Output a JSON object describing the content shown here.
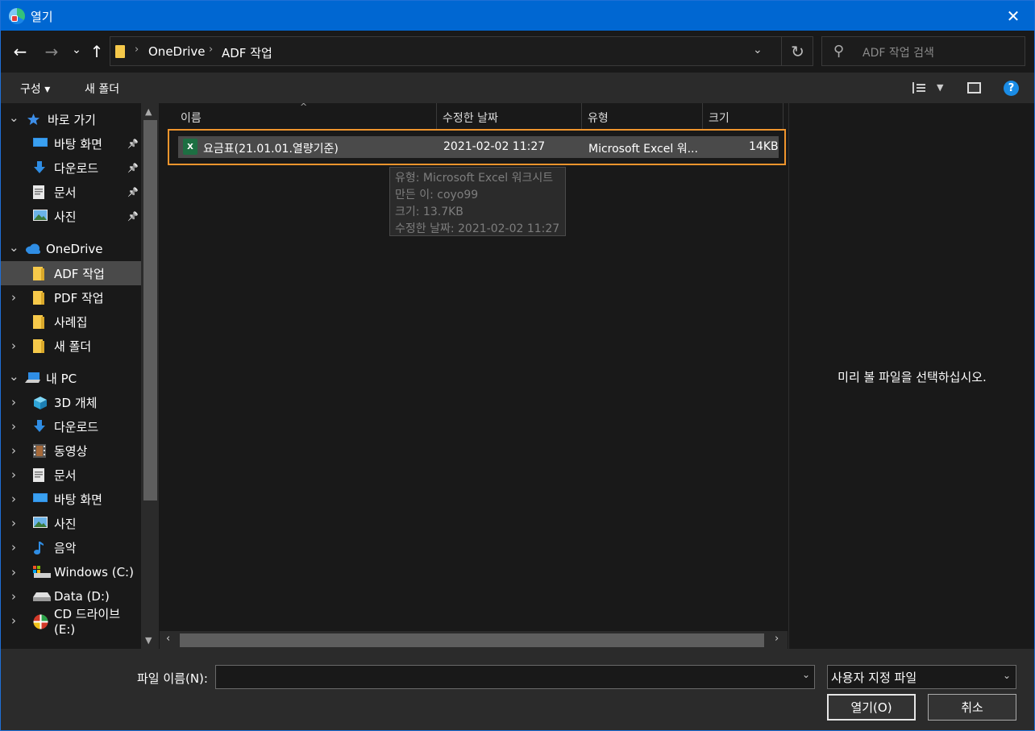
{
  "window": {
    "title": "열기",
    "close_glyph": "✕"
  },
  "nav": {
    "back_glyph": "←",
    "forward_glyph": "→",
    "recent_glyph": "⌄",
    "up_glyph": "↑",
    "breadcrumb": [
      "OneDrive",
      "ADF 작업"
    ],
    "refresh_glyph": "↻",
    "search_placeholder": "ADF 작업 검색"
  },
  "toolbar": {
    "organize_label": "구성 ▾",
    "new_folder_label": "새 폴더",
    "help_glyph": "?"
  },
  "sidebar": {
    "items": [
      {
        "label": "바로 가기",
        "icon": "star-icon",
        "chevron": "⌄"
      },
      {
        "label": "바탕 화면",
        "icon": "desktop-icon",
        "pinned": true
      },
      {
        "label": "다운로드",
        "icon": "download-icon",
        "pinned": true
      },
      {
        "label": "문서",
        "icon": "document-icon",
        "pinned": true
      },
      {
        "label": "사진",
        "icon": "pictures-icon",
        "pinned": true
      },
      {
        "label": "OneDrive",
        "icon": "cloud-icon",
        "chevron": "⌄"
      },
      {
        "label": "ADF 작업",
        "icon": "folder-icon",
        "selected": true
      },
      {
        "label": "PDF 작업",
        "icon": "folder-icon",
        "chevron": "›"
      },
      {
        "label": "사례집",
        "icon": "folder-icon"
      },
      {
        "label": "새 폴더",
        "icon": "folder-icon",
        "chevron": "›"
      },
      {
        "label": "내 PC",
        "icon": "pc-icon",
        "chevron": "⌄"
      },
      {
        "label": "3D 개체",
        "icon": "cube-icon",
        "chevron": "›"
      },
      {
        "label": "다운로드",
        "icon": "download-icon",
        "chevron": "›"
      },
      {
        "label": "동영상",
        "icon": "video-icon",
        "chevron": "›"
      },
      {
        "label": "문서",
        "icon": "document-icon",
        "chevron": "›"
      },
      {
        "label": "바탕 화면",
        "icon": "desktop-icon",
        "chevron": "›"
      },
      {
        "label": "사진",
        "icon": "pictures-icon",
        "chevron": "›"
      },
      {
        "label": "음악",
        "icon": "music-icon",
        "chevron": "›"
      },
      {
        "label": "Windows (C:)",
        "icon": "drive-c-icon",
        "chevron": "›"
      },
      {
        "label": "Data (D:)",
        "icon": "drive-d-icon",
        "chevron": "›"
      },
      {
        "label": "CD 드라이브 (E:)",
        "icon": "cd-drive-icon",
        "chevron": "›"
      }
    ]
  },
  "columns": {
    "name": "이름",
    "modified": "수정한 날짜",
    "type": "유형",
    "size": "크기"
  },
  "files": [
    {
      "name": "요금표(21.01.01.열량기준)",
      "modified": "2021-02-02 11:27",
      "type": "Microsoft Excel 워...",
      "size": "14KB",
      "icon_text": "X"
    }
  ],
  "tooltip": {
    "line1": "유형: Microsoft Excel 워크시트",
    "line2": "만든 이: coyo99",
    "line3": "크기: 13.7KB",
    "line4": "수정한 날짜: 2021-02-02 11:27"
  },
  "preview": {
    "message": "미리 볼 파일을 선택하십시오."
  },
  "bottom": {
    "filename_label": "파일 이름(N):",
    "filename_value": "",
    "filetype_value": "사용자 지정 파일",
    "open_label": "열기(O)",
    "cancel_label": "취소"
  }
}
